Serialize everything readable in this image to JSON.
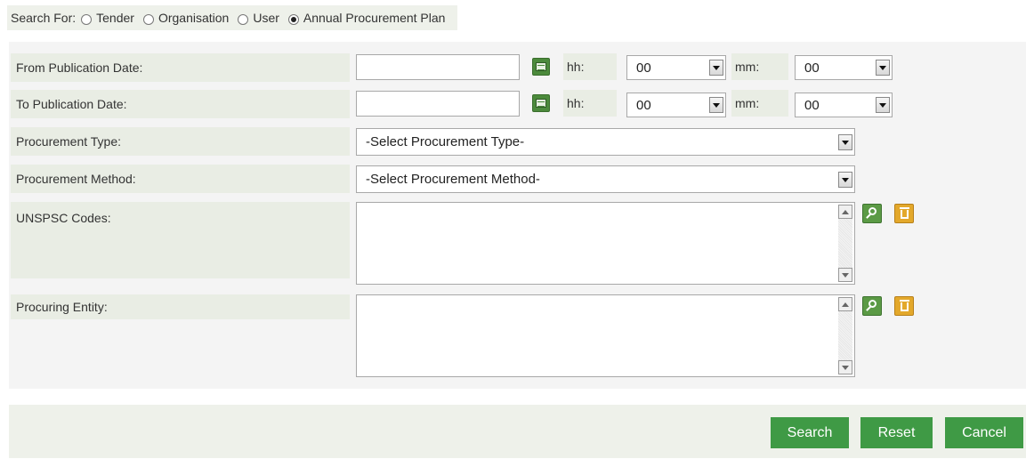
{
  "search_for": {
    "label": "Search For:",
    "options": [
      {
        "label": "Tender",
        "selected": false
      },
      {
        "label": "Organisation",
        "selected": false
      },
      {
        "label": "User",
        "selected": false
      },
      {
        "label": "Annual Procurement Plan",
        "selected": true
      }
    ]
  },
  "form": {
    "from_date": {
      "label": "From Publication Date:",
      "value": "",
      "hh_label": "hh:",
      "hh_value": "00",
      "mm_label": "mm:",
      "mm_value": "00"
    },
    "to_date": {
      "label": "To Publication Date:",
      "value": "",
      "hh_label": "hh:",
      "hh_value": "00",
      "mm_label": "mm:",
      "mm_value": "00"
    },
    "procurement_type": {
      "label": "Procurement Type:",
      "value": "-Select Procurement Type-"
    },
    "procurement_method": {
      "label": "Procurement Method:",
      "value": "-Select Procurement Method-"
    },
    "unspsc": {
      "label": "UNSPSC Codes:",
      "value": ""
    },
    "procuring_entity": {
      "label": "Procuring Entity:",
      "value": ""
    }
  },
  "buttons": {
    "search": "Search",
    "reset": "Reset",
    "cancel": "Cancel"
  },
  "icons": {
    "calendar": "calendar-icon",
    "lookup": "magnifier-icon",
    "delete": "trash-icon"
  },
  "colors": {
    "primary_button": "#3f9a45",
    "label_bg": "#e9ede4"
  }
}
